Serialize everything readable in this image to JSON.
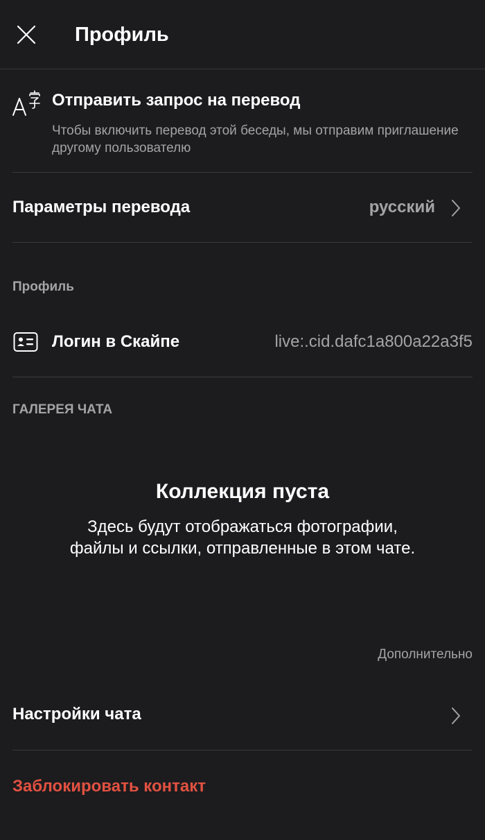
{
  "header": {
    "title": "Профиль",
    "close_icon": "close-icon"
  },
  "translate_request": {
    "icon": "translate-icon",
    "title": "Отправить запрос на перевод",
    "description": "Чтобы включить перевод этой беседы, мы отправим приглашение другому пользователю"
  },
  "translate_settings": {
    "label": "Параметры перевода",
    "value": "русский",
    "chevron_icon": "chevron-right-icon"
  },
  "profile_section": {
    "label": "Профиль",
    "skype_login": {
      "icon": "id-card-icon",
      "label": "Логин в Скайпе",
      "value": "live:.cid.dafc1a800a22a3f5"
    }
  },
  "gallery_section": {
    "label": "ГАЛЕРЕЯ ЧАТА",
    "empty_title": "Коллекция пуста",
    "empty_description": "Здесь будут отображаться фотографии, файлы и ссылки, отправленные в этом чате."
  },
  "more": {
    "label": "Дополнительно"
  },
  "chat_settings": {
    "label": "Настройки чата",
    "chevron_icon": "chevron-right-icon"
  },
  "block_contact": {
    "label": "Заблокировать контакт",
    "color": "#e25141"
  },
  "colors": {
    "background": "#1c1c1e",
    "primary_text": "#ffffff",
    "secondary_text": "#a4a4a8",
    "divider": "#3a3a3c",
    "danger": "#e25141"
  }
}
